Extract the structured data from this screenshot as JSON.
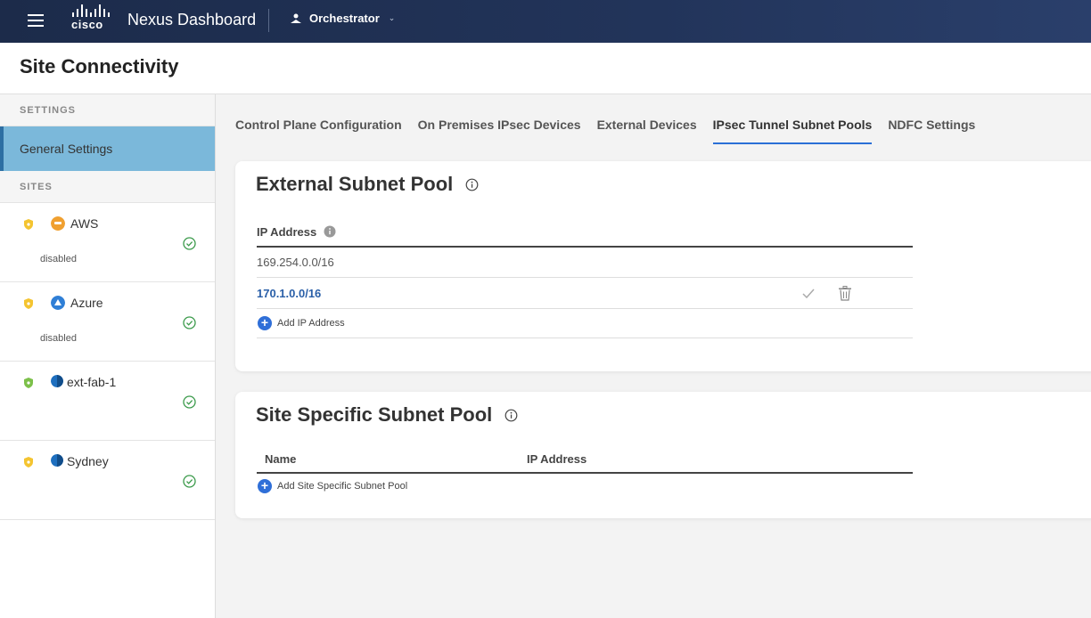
{
  "topbar": {
    "brand_word": "cisco",
    "app_title": "Nexus Dashboard",
    "service": "Orchestrator",
    "colors": {
      "background": "#1c2b4a",
      "text": "#ffffff"
    }
  },
  "page": {
    "title": "Site Connectivity"
  },
  "sidebar": {
    "settings_label": "SETTINGS",
    "active_item": "General Settings",
    "sites_label": "SITES",
    "sites": [
      {
        "name": "AWS",
        "status": "disabled",
        "provider_icon": "aws-icon",
        "provider_color": "#f0a030",
        "shield_color": "#f4c430"
      },
      {
        "name": "Azure",
        "status": "disabled",
        "provider_icon": "azure-icon",
        "provider_color": "#2f7fd6",
        "shield_color": "#f4c430"
      },
      {
        "name": "ext-fab-1",
        "status": "",
        "provider_icon": "ndfc-globe-icon",
        "provider_color": "#1e6fbf",
        "shield_color": "#7cc04a"
      },
      {
        "name": "Sydney",
        "status": "",
        "provider_icon": "ndfc-globe-icon",
        "provider_color": "#1e6fbf",
        "shield_color": "#f4c430"
      }
    ],
    "colors": {
      "active_bg": "#7bb8da",
      "active_border": "#2d6fa3",
      "ok_check": "#3a9a4a"
    }
  },
  "tabs": [
    {
      "label": "Control Plane Configuration",
      "active": false
    },
    {
      "label": "On Premises IPsec Devices",
      "active": false
    },
    {
      "label": "External Devices",
      "active": false
    },
    {
      "label": "IPsec Tunnel Subnet Pools",
      "active": true
    },
    {
      "label": "NDFC Settings",
      "active": false
    }
  ],
  "external_pool": {
    "title": "External Subnet Pool",
    "column_header": "IP Address",
    "rows": [
      {
        "ip": "169.254.0.0/16",
        "editing": false
      },
      {
        "ip": "170.1.0.0/16",
        "editing": true
      }
    ],
    "add_label": "Add IP Address"
  },
  "site_pool": {
    "title": "Site Specific Subnet Pool",
    "columns": [
      "Name",
      "IP Address"
    ],
    "add_label": "Add Site Specific Subnet Pool"
  },
  "accent_color": "#2a6fd6"
}
